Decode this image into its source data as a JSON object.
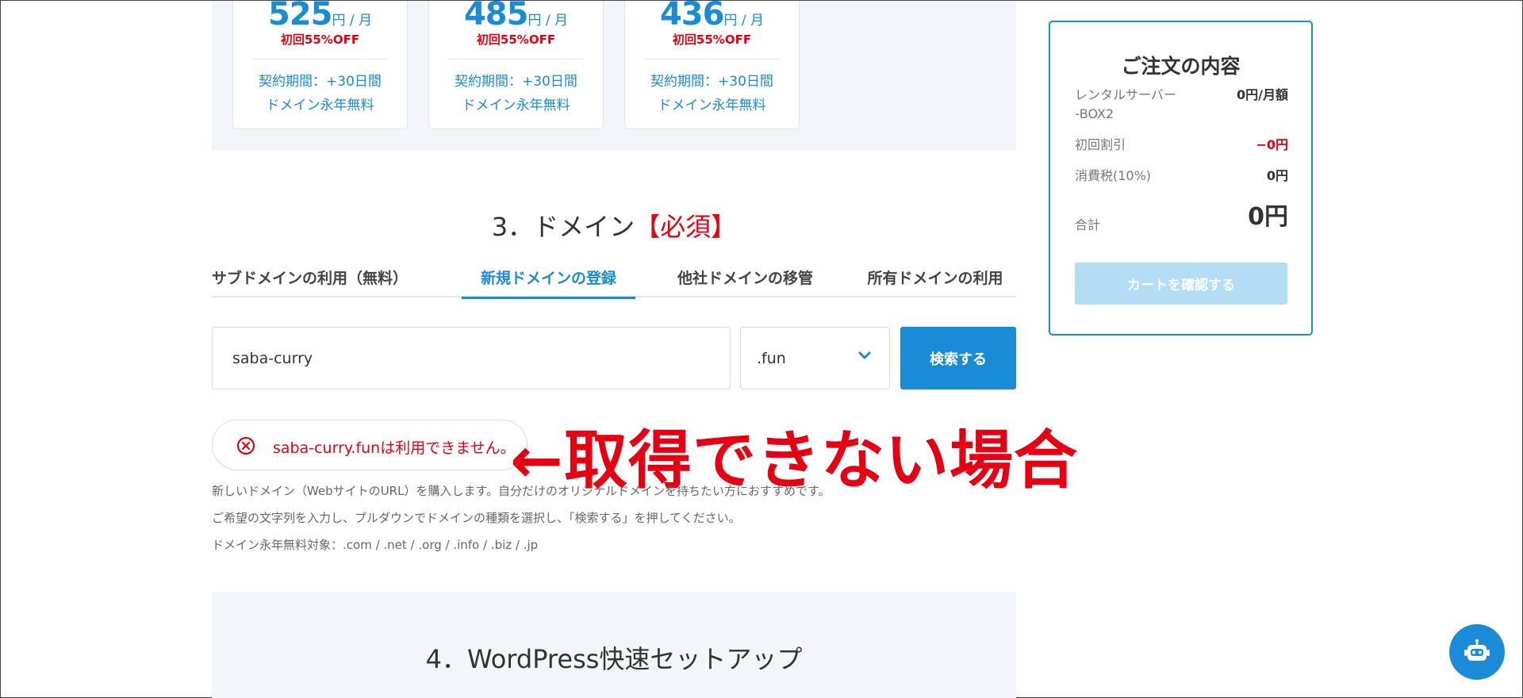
{
  "plans": [
    {
      "price": "525",
      "unit": "円 / 月",
      "discount": "初回55%OFF",
      "term": "契約期間：+30日間",
      "domain": "ドメイン永年無料"
    },
    {
      "price": "485",
      "unit": "円 / 月",
      "discount": "初回55%OFF",
      "term": "契約期間：+30日間",
      "domain": "ドメイン永年無料"
    },
    {
      "price": "436",
      "unit": "円 / 月",
      "discount": "初回55%OFF",
      "term": "契約期間：+30日間",
      "domain": "ドメイン永年無料"
    }
  ],
  "domain_section": {
    "title": "3．ドメイン",
    "required": "【必須】",
    "tabs": [
      {
        "label": "サブドメインの利用（無料）"
      },
      {
        "label": "新規ドメインの登録"
      },
      {
        "label": "他社ドメインの移管"
      },
      {
        "label": "所有ドメインの利用"
      }
    ],
    "active_tab": 1,
    "input_value": "saba-curry",
    "tld_selected": ".fun",
    "search_label": "検索する",
    "error_message": "saba-curry.funは利用できません。",
    "annotation": "←取得できない場合",
    "help_lines": [
      "新しいドメイン（WebサイトのURL）を購入します。自分だけのオリジナルドメインを持ちたい方におすすめです。",
      "ご希望の文字列を入力し、プルダウンでドメインの種類を選択し、「検索する」を押してください。",
      "ドメイン永年無料対象：.com / .net / .org / .info / .biz / .jp"
    ]
  },
  "wordpress_section": {
    "title": "4．WordPress快速セットアップ"
  },
  "order_summary": {
    "title": "ご注文の内容",
    "rows": [
      {
        "label": "レンタルサーバー\n-BOX2",
        "amount": "0円/月額"
      },
      {
        "label": "初回割引",
        "amount": "−0円"
      },
      {
        "label": "消費税(10%)",
        "amount": "0円"
      }
    ],
    "total_label": "合計",
    "total_amount": "0円",
    "cart_button": "カートを確認する"
  },
  "colors": {
    "accent": "#1a8bd6",
    "error": "#e60012",
    "band": "#f2f6fb"
  },
  "icons": {
    "error": "x-circle-icon",
    "dropdown": "chevron-down-icon",
    "chat": "robot-icon"
  }
}
